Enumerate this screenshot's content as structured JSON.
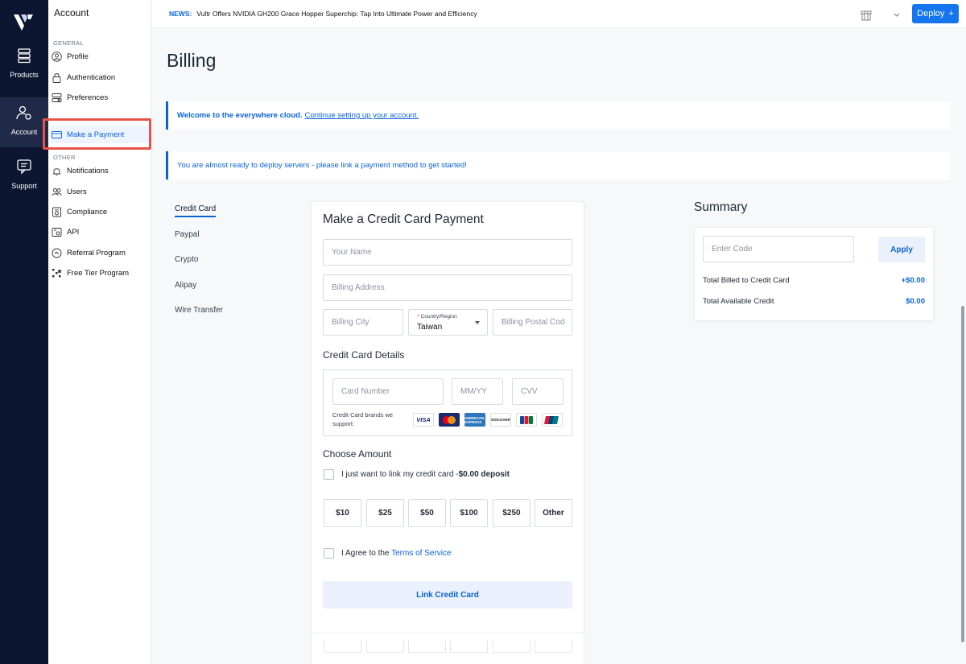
{
  "rail": {
    "items": [
      {
        "label": "Products"
      },
      {
        "label": "Account"
      },
      {
        "label": "Support"
      }
    ]
  },
  "subnav": {
    "title": "Account",
    "general_label": "GENERAL",
    "other_label": "OTHER",
    "general": [
      {
        "label": "Profile"
      },
      {
        "label": "Authentication"
      },
      {
        "label": "Preferences"
      },
      {
        "label": "Make a Payment"
      }
    ],
    "other": [
      {
        "label": "Notifications"
      },
      {
        "label": "Users"
      },
      {
        "label": "Compliance"
      },
      {
        "label": "API"
      },
      {
        "label": "Referral Program"
      },
      {
        "label": "Free Tier Program"
      }
    ]
  },
  "topbar": {
    "news_tag": "NEWS:",
    "news_text": "Vultr Offers NVIDIA GH200 Grace Hopper Superchip: Tap Into Ultimate Power and Efficiency",
    "deploy_label": "Deploy",
    "deploy_icon": "+"
  },
  "page": {
    "title": "Billing",
    "banner_welcome_strong": "Welcome to the everywhere cloud.",
    "banner_welcome_link": "Continue setting up your account.",
    "banner_ready": "You are almost ready to deploy servers - please link a payment method to get started!"
  },
  "payment_methods": [
    {
      "label": "Credit Card",
      "active": true
    },
    {
      "label": "Paypal",
      "active": false
    },
    {
      "label": "Crypto",
      "active": false
    },
    {
      "label": "Alipay",
      "active": false
    },
    {
      "label": "Wire Transfer",
      "active": false
    }
  ],
  "form": {
    "title": "Make a Credit Card Payment",
    "name_placeholder": "Your Name",
    "address_placeholder": "Billing Address",
    "city_placeholder": "Billing City",
    "country_label": "Country/Region",
    "country_required": "*",
    "country_value": "Taiwan",
    "postal_placeholder": "Billing Postal Cod",
    "cc_title": "Credit Card Details",
    "card_number_placeholder": "Card Number",
    "expiry_placeholder": "MM/YY",
    "cvv_placeholder": "CVV",
    "brands_label": "Credit Card brands we support:",
    "brands": [
      {
        "name": "VISA",
        "icon": "visa-icon"
      },
      {
        "name": "Mastercard",
        "icon": "mastercard-icon"
      },
      {
        "name": "American Express",
        "icon": "amex-icon"
      },
      {
        "name": "DISCOVER",
        "icon": "discover-icon"
      },
      {
        "name": "JCB",
        "icon": "jcb-icon"
      },
      {
        "name": "UnionPay",
        "icon": "unionpay-icon"
      }
    ],
    "amount_title": "Choose Amount",
    "link_only_text": "I just want to link my credit card -",
    "link_only_bold": "$0.00 deposit",
    "amounts": [
      "$10",
      "$25",
      "$50",
      "$100",
      "$250",
      "Other"
    ],
    "agree_text": "I Agree to the",
    "terms_link": "Terms of Service",
    "submit_label": "Link Credit Card"
  },
  "summary": {
    "title": "Summary",
    "code_placeholder": "Enter Code",
    "apply_label": "Apply",
    "billed_label": "Total Billed to Credit Card",
    "billed_value": "+$0.00",
    "credit_label": "Total Available Credit",
    "credit_value": "$0.00"
  },
  "colors": {
    "accent": "#0b63d8",
    "rail_bg": "#0c1631",
    "highlight": "#e8524a"
  }
}
